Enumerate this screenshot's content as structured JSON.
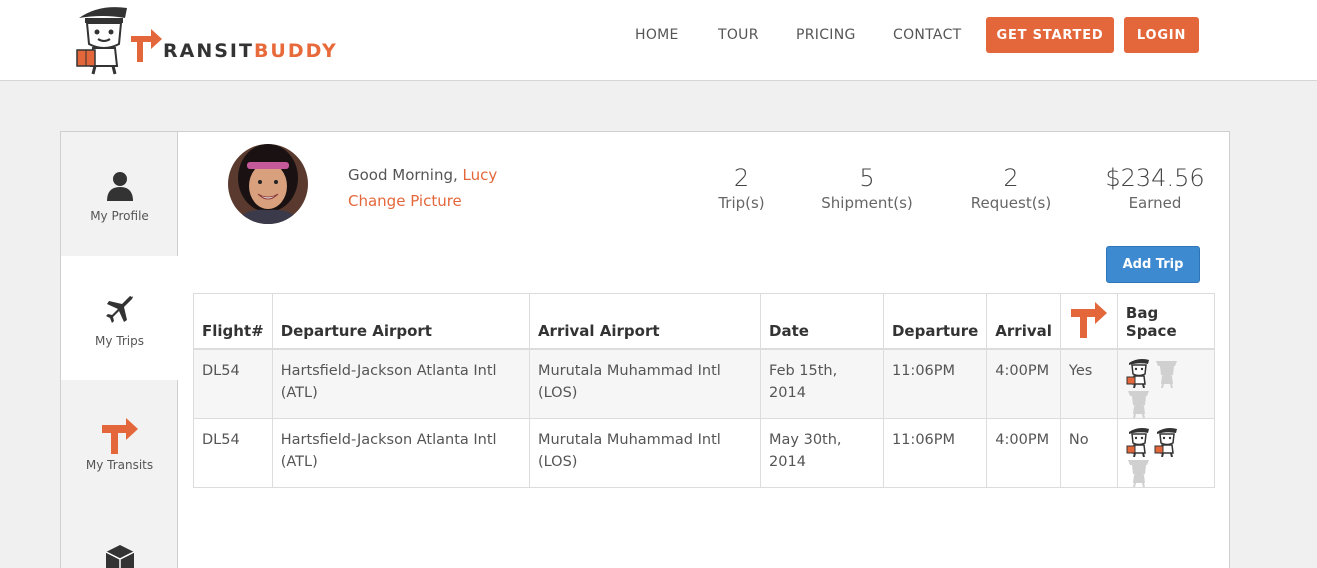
{
  "brand": {
    "name_prefix": "T",
    "name_mid": "RANSIT",
    "name_suffix": "BUDDY",
    "accent": "#e4673b",
    "blue": "#3e8ad0"
  },
  "nav": {
    "home": "HOME",
    "tour": "TOUR",
    "pricing": "PRICING",
    "contact": "CONTACT",
    "get_started": "GET STARTED",
    "login": "LOGIN"
  },
  "sidebar": {
    "items": [
      {
        "label": "My Profile",
        "icon": "user-icon"
      },
      {
        "label": "My Trips",
        "icon": "airplane-icon"
      },
      {
        "label": "My Transits",
        "icon": "transit-arrow-icon"
      },
      {
        "label": "",
        "icon": "box-icon"
      }
    ]
  },
  "profile": {
    "greeting": "Good Morning, ",
    "name": "Lucy",
    "change_picture": "Change Picture"
  },
  "stats": [
    {
      "value": "2",
      "label": "Trip(s)"
    },
    {
      "value": "5",
      "label": "Shipment(s)"
    },
    {
      "value": "2",
      "label": "Request(s)"
    },
    {
      "value": "$234.56",
      "label": "Earned"
    }
  ],
  "add_trip": "Add Trip",
  "table": {
    "headers": [
      "Flight#",
      "Departure Airport",
      "Arrival Airport",
      "Date",
      "Departure",
      "Arrival",
      "",
      "Bag Space"
    ],
    "transit_header_icon": "transit-arrow-icon",
    "rows": [
      {
        "flight": "DL54",
        "dep_airport_1": "Hartsfield-Jackson Atlanta Intl",
        "dep_airport_2": "(ATL)",
        "arr_airport_1": "Murutala Muhammad Intl",
        "arr_airport_2": "(LOS)",
        "date_1": "Feb 15th, 2014",
        "date_2": "",
        "departure": "11:06PM",
        "arrival": "4:00PM",
        "transit": "Yes",
        "bag_space_filled": 1,
        "bag_space_total": 3
      },
      {
        "flight": "DL54",
        "dep_airport_1": "Hartsfield-Jackson Atlanta Intl",
        "dep_airport_2": "(ATL)",
        "arr_airport_1": "Murutala Muhammad Intl",
        "arr_airport_2": "(LOS)",
        "date_1": "May 30th,",
        "date_2": "2014",
        "departure": "11:06PM",
        "arrival": "4:00PM",
        "transit": "No",
        "bag_space_filled": 2,
        "bag_space_total": 3
      }
    ]
  }
}
